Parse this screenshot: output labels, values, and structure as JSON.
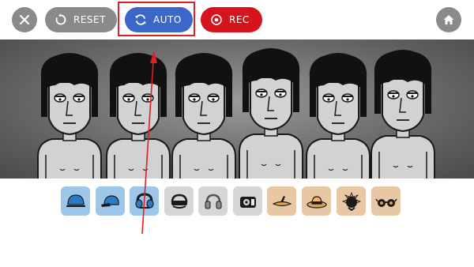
{
  "toolbar": {
    "reset_label": "RESET",
    "auto_label": "AUTO",
    "rec_label": "REC"
  },
  "colors": {
    "grey_button": "#8a8a8a",
    "auto_blue": "#3b67c9",
    "rec_red": "#d7131c",
    "highlight_red": "#e02020",
    "sound_blue": "#9ec6e8",
    "sound_grey": "#d6d6d6",
    "sound_orange": "#e8c8a4"
  },
  "characters": [
    {
      "icon": "singer-character"
    },
    {
      "icon": "singer-character"
    },
    {
      "icon": "singer-character"
    },
    {
      "icon": "singer-character"
    },
    {
      "icon": "singer-character"
    },
    {
      "icon": "singer-character"
    }
  ],
  "sound_icons": [
    {
      "icon": "blue-cap-icon",
      "group": "blue"
    },
    {
      "icon": "blue-cap-sideways-icon",
      "group": "blue"
    },
    {
      "icon": "blue-headphones-icon",
      "group": "blue"
    },
    {
      "icon": "grey-visor-icon",
      "group": "grey"
    },
    {
      "icon": "grey-headphones-icon",
      "group": "grey"
    },
    {
      "icon": "grey-speaker-icon",
      "group": "grey"
    },
    {
      "icon": "orange-flat-hat-icon",
      "group": "orange"
    },
    {
      "icon": "orange-straw-hat-icon",
      "group": "orange"
    },
    {
      "icon": "orange-sun-mask-icon",
      "group": "orange"
    },
    {
      "icon": "orange-glasses-icon",
      "group": "orange"
    }
  ]
}
